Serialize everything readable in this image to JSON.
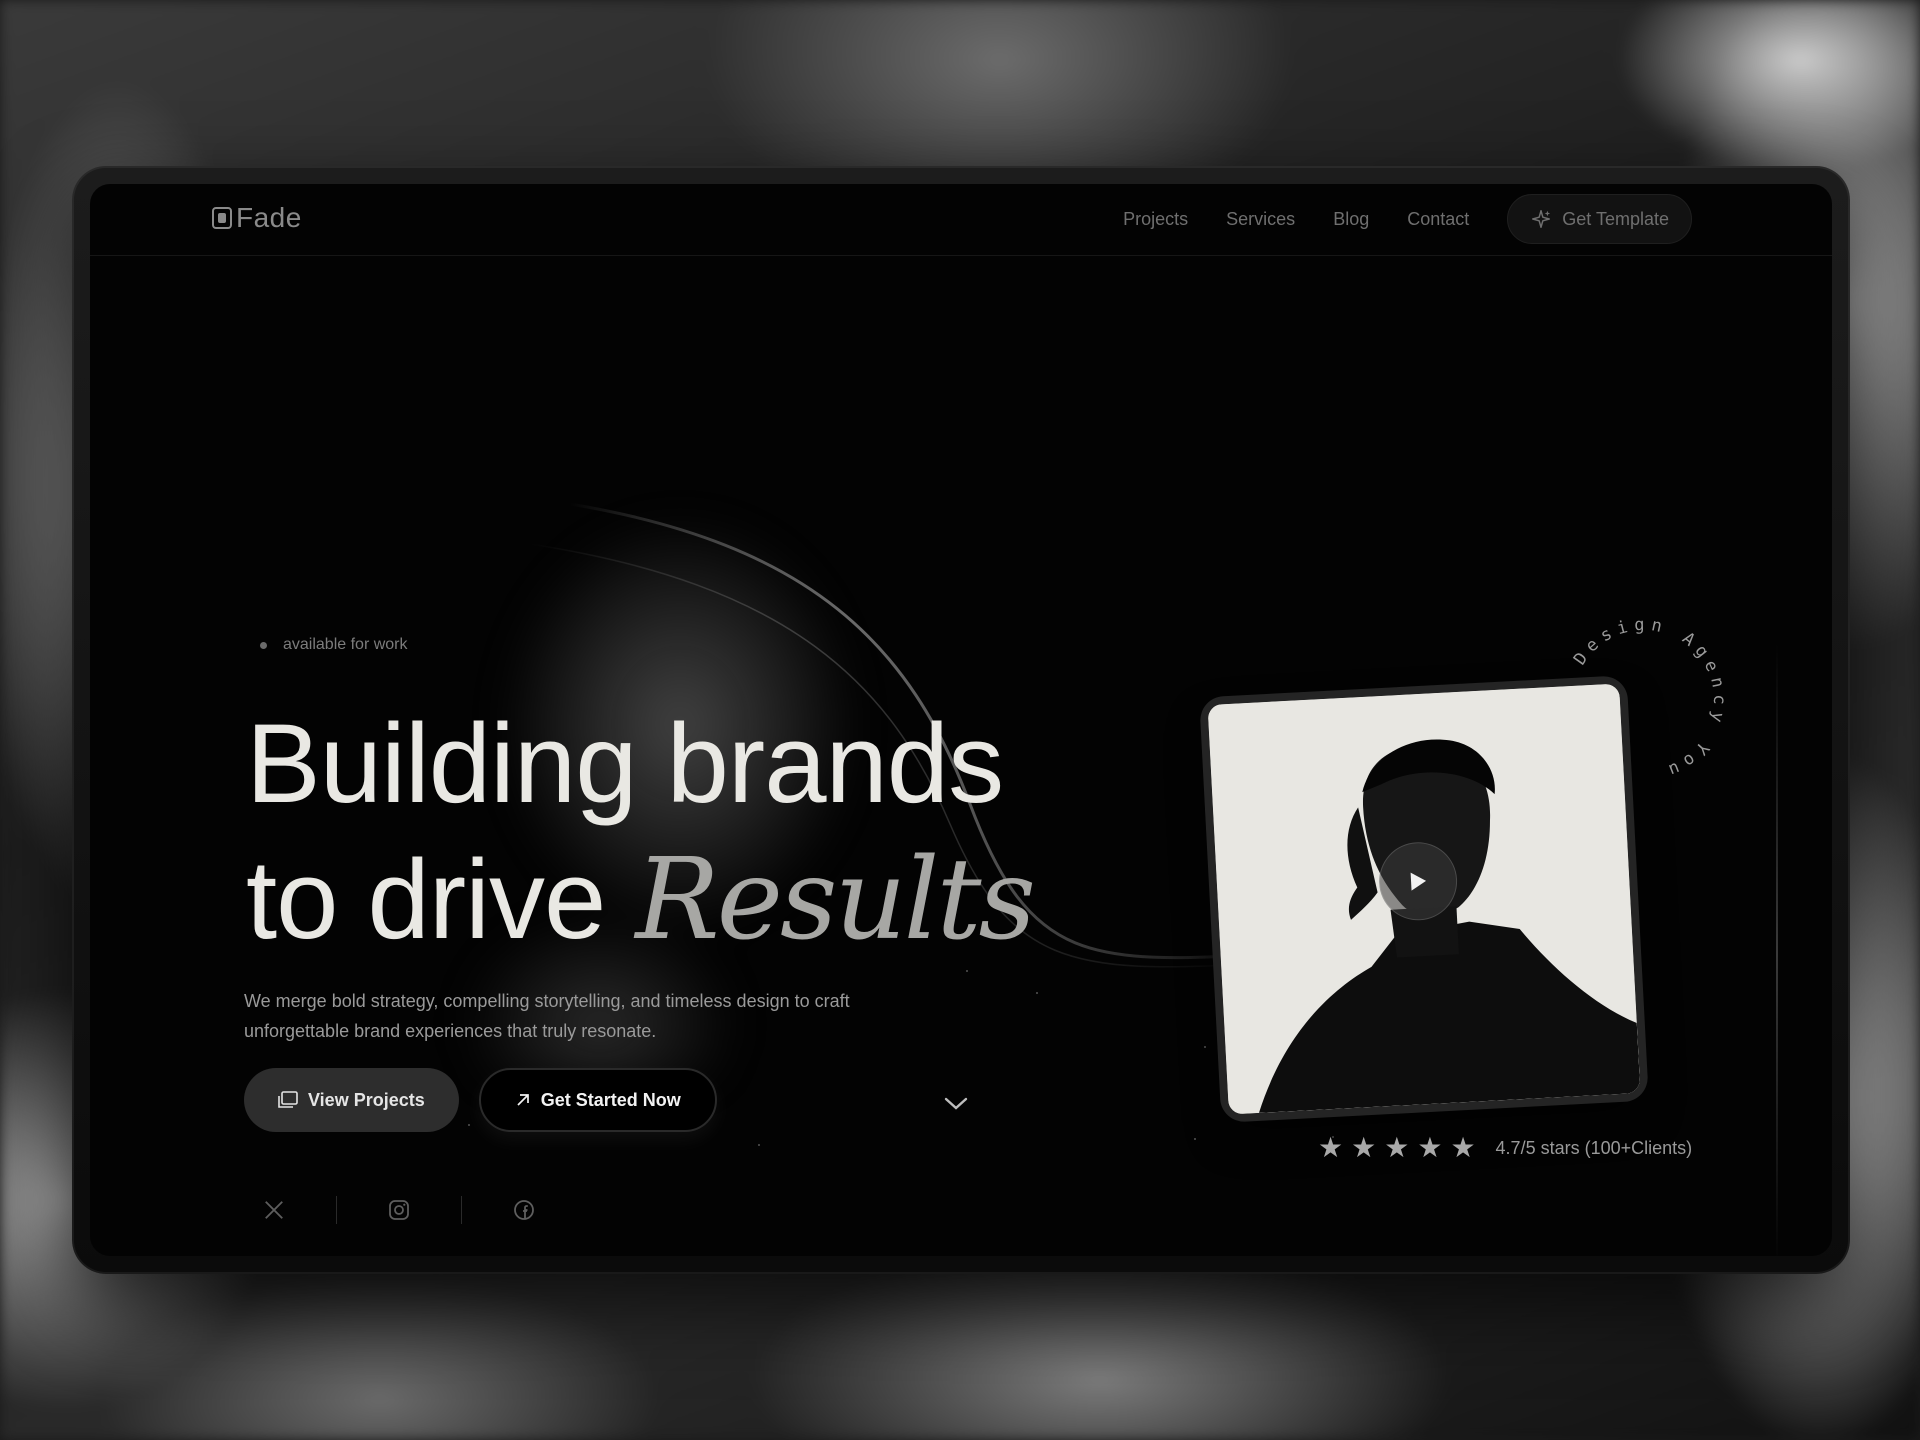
{
  "brand": {
    "name": "Fade"
  },
  "nav": {
    "links": [
      {
        "label": "Projects"
      },
      {
        "label": "Services"
      },
      {
        "label": "Blog"
      },
      {
        "label": "Contact"
      }
    ],
    "cta_label": "Get Template"
  },
  "hero": {
    "badge": "available for work",
    "headline_line1": "Building brands",
    "headline_line2_prefix": "to drive",
    "headline_line2_italic": "Results",
    "description_line1": "We merge bold strategy, compelling storytelling, and timeless design to craft",
    "description_line2": "unforgettable brand experiences that truly resonate.",
    "primary_button": "Get Started Now",
    "secondary_button": "View Projects"
  },
  "socials": [
    {
      "icon": "x-icon"
    },
    {
      "icon": "instagram-icon"
    },
    {
      "icon": "facebook-icon"
    }
  ],
  "portrait": {
    "circle_text": "Design Agency You"
  },
  "rating": {
    "stars": 5,
    "text": "4.7/5 stars (100+Clients)"
  },
  "colors": {
    "background": "#030303",
    "headline": "#e9e8e3",
    "accent_muted": "#a7a7a4"
  }
}
